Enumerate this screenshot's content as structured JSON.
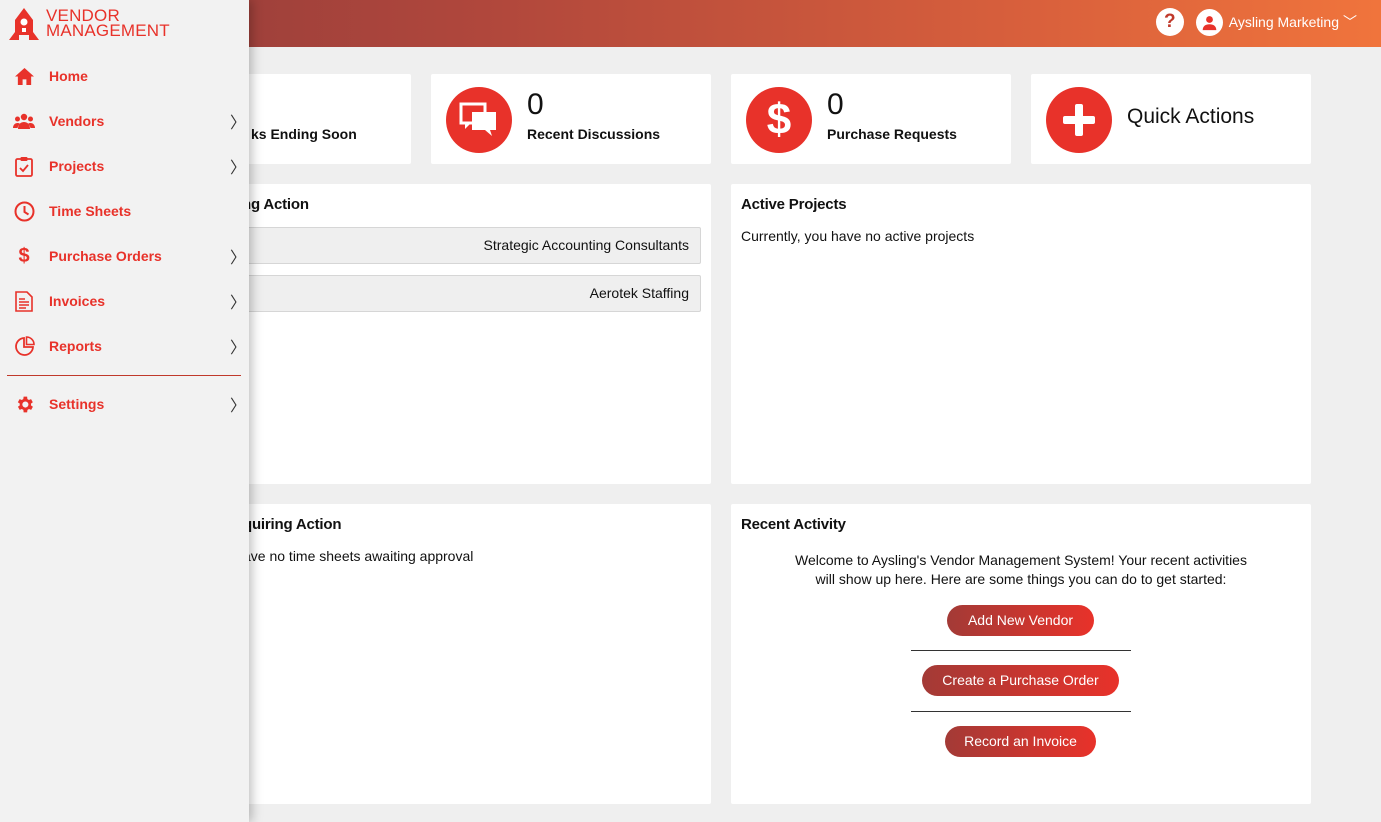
{
  "app": {
    "logo_line1": "VENDOR",
    "logo_line2": "MANAGEMENT"
  },
  "header": {
    "help_glyph": "?",
    "user_name": "Aysling Marketing",
    "user_chevron": "﹀"
  },
  "sidebar": {
    "items": [
      {
        "label": "Home",
        "icon": "home-icon"
      },
      {
        "label": "Vendors",
        "icon": "users-icon",
        "chevron": "〉"
      },
      {
        "label": "Projects",
        "icon": "clipboard-check-icon",
        "chevron": "〉"
      },
      {
        "label": "Time Sheets",
        "icon": "clock-icon"
      },
      {
        "label": "Purchase Orders",
        "icon": "dollar-icon",
        "chevron": "〉"
      },
      {
        "label": "Invoices",
        "icon": "invoice-icon",
        "chevron": "〉"
      },
      {
        "label": "Reports",
        "icon": "reports-icon",
        "chevron": "〉"
      },
      {
        "label": "Settings",
        "icon": "gear-icon",
        "chevron": "〉"
      }
    ]
  },
  "stats": {
    "tasks_label": "ks Ending Soon",
    "discussions_count": "0",
    "discussions_label": "Recent Discussions",
    "purchase_count": "0",
    "purchase_label": "Purchase Requests",
    "quick_actions_label": "Quick Actions"
  },
  "pending_panel": {
    "title": "ng Action",
    "rows": [
      "Strategic Accounting Consultants",
      "Aerotek Staffing"
    ]
  },
  "active_projects": {
    "title": "Active Projects",
    "text": "Currently, you have no active projects"
  },
  "timesheets_panel": {
    "title": "quiring Action",
    "text": "ave no time sheets awaiting approval"
  },
  "recent_activity": {
    "title": "Recent Activity",
    "welcome_line1": "Welcome to Aysling's Vendor Management System! Your recent activities",
    "welcome_line2": "will show up here. Here are some things you can do to get started:",
    "buttons": [
      "Add New Vendor",
      "Create a Purchase Order",
      "Record an Invoice"
    ]
  },
  "colors": {
    "accent": "#e8322a",
    "header_start": "#8e3a3a",
    "header_end": "#f0743c"
  }
}
